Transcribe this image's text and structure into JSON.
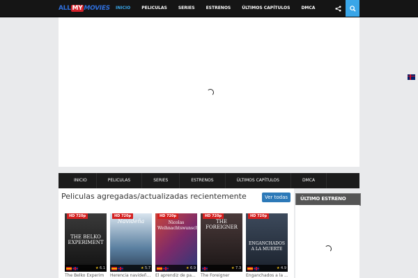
{
  "header": {
    "logo": {
      "part1": "ALL",
      "part2": "MY",
      "part3": "MOVIES"
    },
    "nav": [
      {
        "label": "INICIO",
        "active": true
      },
      {
        "label": "PELICULAS"
      },
      {
        "label": "SERIES"
      },
      {
        "label": "ESTRENOS"
      },
      {
        "label": "ÚLTIMOS CAPÍTULOS"
      },
      {
        "label": "DMCA"
      }
    ],
    "share_icon": "share-icon",
    "search_icon": "search-icon",
    "accent": "#3aa6e8"
  },
  "main_nav": [
    {
      "label": "INICIO"
    },
    {
      "label": "PELICULAS"
    },
    {
      "label": "SERIES"
    },
    {
      "label": "ESTRENOS"
    },
    {
      "label": "ÚLTIMOS CAPÍTULOS"
    },
    {
      "label": "DMCA"
    }
  ],
  "section": {
    "title": "Peliculas agregadas/actualizadas recientemente",
    "view_all": "Ver todas"
  },
  "movies": [
    {
      "badge": "HD 720p",
      "poster_text": "THE BELKO EXPERIMENT",
      "rating": "6.1",
      "title": "The Belko Experim",
      "poster_color": "#2a2a2a",
      "langs": [
        "es",
        "uk"
      ]
    },
    {
      "badge": "HD 720p",
      "poster_text": "Navideña",
      "rating": "5.7",
      "title": "Herencia navideñ...",
      "poster_color": "#4a6c8c",
      "langs": [
        "es",
        "uk"
      ]
    },
    {
      "badge": "HD 720p",
      "poster_text": "Nicolas Weihnachtswunsch",
      "rating": "6.9",
      "title": "El aprendiz de pa...",
      "poster_color": "#8c3b2c",
      "langs": [
        "es",
        "uk"
      ]
    },
    {
      "badge": "HD 720p",
      "poster_text": "THE FOREIGNER",
      "rating": "7.3",
      "title": "The Foreigner",
      "poster_color": "#3a3030",
      "langs": [
        "uk"
      ]
    },
    {
      "badge": "HD 720p",
      "poster_text": "ENGANCHADOS A LA MUERTE",
      "rating": "4.9",
      "title": "Enganchados a la ...",
      "poster_color": "#2f3b4b",
      "langs": [
        "es",
        "uk"
      ]
    }
  ],
  "sidebar": {
    "title": "ÚLTIMO ESTRENO"
  }
}
